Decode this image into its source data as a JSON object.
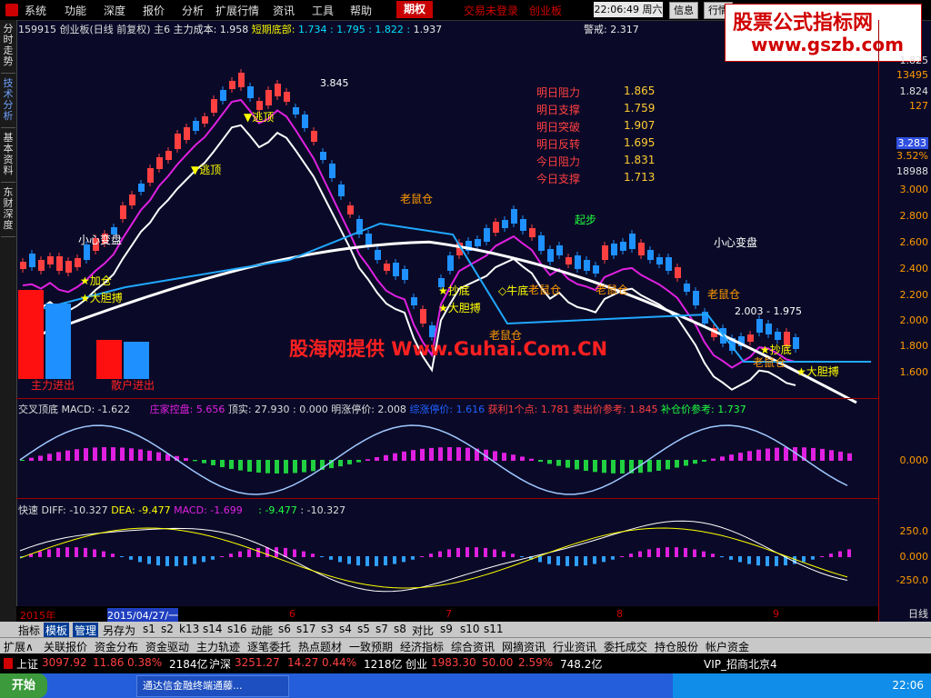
{
  "menu": {
    "items": [
      "系统",
      "功能",
      "深度",
      "报价",
      "分析",
      "扩展行情",
      "资讯",
      "工具",
      "帮助"
    ],
    "active": "期权",
    "links": [
      "交易未登录",
      "创业板"
    ],
    "clock": "22:06:49 周六",
    "buttons": [
      "信息",
      "行情"
    ]
  },
  "watermark": {
    "line1": "股票公式指标网",
    "line2": "www.gszb.com"
  },
  "sidetabs": [
    "分时走势",
    "技术分析",
    "基本资料",
    "东财深度"
  ],
  "header": {
    "code": "159915 创业板(日线 前复权)",
    "main": "主6",
    "cost_label": "主力成本:",
    "cost": "1.958",
    "short_label": "短期底部:",
    "short_vals": "1.734 : 1.795 : 1.822 :",
    "last": "1.937",
    "warn": "警戒: 2.317"
  },
  "right_axis": {
    "top": [
      "1.825",
      "13495",
      "1.824",
      "127"
    ],
    "highlight": "3.283",
    "pct": "3.52%",
    "vol": "18988",
    "prices": [
      "3.000",
      "2.800",
      "2.600",
      "2.400",
      "2.200",
      "2.000",
      "1.800",
      "1.600"
    ],
    "mid": [
      "0.000"
    ],
    "low": [
      "250.0",
      "0.000",
      "-250.0"
    ],
    "bottom": "日线"
  },
  "predict": [
    {
      "label": "明日阻力",
      "value": "1.865"
    },
    {
      "label": "明日支撑",
      "value": "1.759"
    },
    {
      "label": "明日突破",
      "value": "1.907"
    },
    {
      "label": "明日反转",
      "value": "1.695"
    },
    {
      "label": "今日阻力",
      "value": "1.831"
    },
    {
      "label": "今日支撑",
      "value": "1.713"
    }
  ],
  "annotations": {
    "peak": "3.845",
    "escape1": "▼逃顶",
    "escape2": "▼逃顶",
    "small_change1": "小心变盘",
    "small_change2": "小心变盘",
    "add": "★加仓",
    "bold1": "★大胆搏",
    "rat1": "老鼠仓",
    "rat2": "老鼠仓",
    "rat3": "老鼠仓",
    "rat4": "老鼠仓",
    "rat5": "老鼠仓",
    "rat6": "老鼠仓",
    "rise": "起步",
    "catch": "★抄底",
    "bold2": "★大胆搏",
    "bottom": "◇牛底",
    "range": "2.003 - 1.975",
    "catch2": "★抄底",
    "bold3": "★大胆搏",
    "main_in": "主力进出",
    "retail_in": "散户进出",
    "site": "股海网提供 Www.Guhai.Com.CN"
  },
  "ind1": {
    "name": "交叉顶底",
    "macd": "MACD: -1.622",
    "zhuang": "庄家控盘: 5.656",
    "top": "顶实: 27.930 : 0.000",
    "limit": "明涨停价: 2.008",
    "blue": "综涨停价: 1.616",
    "profit": "获利1个点: 1.781",
    "sell": "卖出价参考: 1.845",
    "buy": "补仓价参考: 1.737"
  },
  "ind2": {
    "name": "快速",
    "diff": "DIFF: -10.327",
    "dea": "DEA: -9.477",
    "macd": "MACD: -1.699",
    "v1": ": -9.477",
    "v2": ": -10.327"
  },
  "xaxis": [
    "2015年",
    "2015/04/27/一",
    "6",
    "7",
    "8",
    "9"
  ],
  "tabbar1": [
    "指标",
    "模板",
    "管理",
    "另存为",
    "s1",
    "s2",
    "k13",
    "s14",
    "s16",
    "动能",
    "s6",
    "s17",
    "s3",
    "s4",
    "s5",
    "s7",
    "s8",
    "对比",
    "s9",
    "s10",
    "s11"
  ],
  "tabbar2": [
    "扩展∧",
    "关联报价",
    "资金分布",
    "资金驱动",
    "主力轨迹",
    "逐笔委托",
    "热点题材",
    "一致预期",
    "经济指标",
    "综合资讯",
    "网摘资讯",
    "行业资讯",
    "委托成交",
    "持仓股份",
    "帐户资金"
  ],
  "ticker": {
    "sh_label": "上证",
    "sh": "3097.92",
    "sh_chg": "11.86",
    "sh_pct": "0.38%",
    "sh_amt": "2184亿",
    "sz_label": "沪深",
    "sz": "3251.27",
    "sz_chg": "14.27",
    "sz_pct": "0.44%",
    "sz_amt": "1218亿",
    "cy_label": "创业",
    "cy": "1983.30",
    "cy_chg": "50.00",
    "cy_pct": "2.59%",
    "cy_amt": "748.2亿",
    "vip": "VIP_招商北京4"
  },
  "taskbar": {
    "start": "开始",
    "item": "通达信金融终端通藤...",
    "time": "22:06"
  },
  "colors": {
    "up": "#ff4040",
    "down": "#1e90ff",
    "bg": "#0a0a28",
    "axis": "#a00000",
    "magenta": "#e020e0",
    "cyan": "#20a8ff",
    "white": "#ffffff"
  }
}
